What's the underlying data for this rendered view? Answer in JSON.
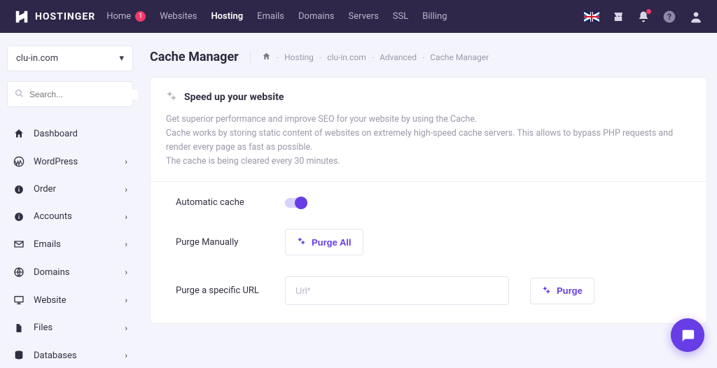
{
  "brand": "HOSTINGER",
  "nav": {
    "items": [
      {
        "label": "Home",
        "badge": "1"
      },
      {
        "label": "Websites"
      },
      {
        "label": "Hosting",
        "active": true
      },
      {
        "label": "Emails"
      },
      {
        "label": "Domains"
      },
      {
        "label": "Servers"
      },
      {
        "label": "SSL"
      },
      {
        "label": "Billing"
      }
    ]
  },
  "sidebar": {
    "site": "clu-in.com",
    "search_placeholder": "Search...",
    "items": [
      {
        "icon": "home",
        "label": "Dashboard",
        "expandable": false
      },
      {
        "icon": "wordpress",
        "label": "WordPress",
        "expandable": true
      },
      {
        "icon": "info",
        "label": "Order",
        "expandable": true
      },
      {
        "icon": "info",
        "label": "Accounts",
        "expandable": true
      },
      {
        "icon": "mail",
        "label": "Emails",
        "expandable": true
      },
      {
        "icon": "globe",
        "label": "Domains",
        "expandable": true
      },
      {
        "icon": "monitor",
        "label": "Website",
        "expandable": true
      },
      {
        "icon": "file",
        "label": "Files",
        "expandable": true
      },
      {
        "icon": "db",
        "label": "Databases",
        "expandable": true
      }
    ]
  },
  "page": {
    "title": "Cache Manager",
    "breadcrumbs": [
      "Hosting",
      "clu-in.com",
      "Advanced",
      "Cache Manager"
    ]
  },
  "card": {
    "title": "Speed up your website",
    "desc1": "Get superior performance and improve SEO for your website by using the Cache.",
    "desc2": "Cache works by storing static content of websites on extremely high-speed cache servers. This allows to bypass PHP requests and render every page as fast as possible.",
    "desc3": "The cache is being cleared every 30 minutes."
  },
  "form": {
    "auto_label": "Automatic cache",
    "purge_manual_label": "Purge Manually",
    "purge_all_btn": "Purge All",
    "purge_url_label": "Purge a specific URL",
    "url_placeholder": "Url*",
    "purge_btn": "Purge"
  }
}
